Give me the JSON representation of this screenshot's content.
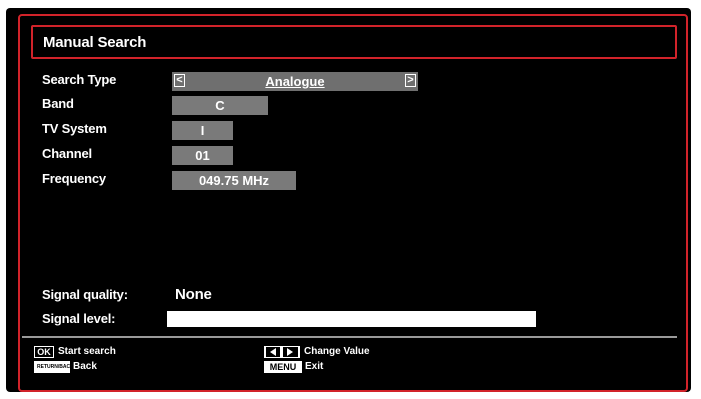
{
  "title": "Manual Search",
  "fields": {
    "search_type": {
      "label": "Search Type",
      "value": "Analogue",
      "left_arrow": "<",
      "right_arrow": ">"
    },
    "band": {
      "label": "Band",
      "value": "C"
    },
    "tv_system": {
      "label": "TV System",
      "value": "I"
    },
    "channel": {
      "label": "Channel",
      "value": "01"
    },
    "frequency": {
      "label": "Frequency",
      "value": "049.75 MHz"
    }
  },
  "signal": {
    "quality_label": "Signal quality:",
    "quality_value": "None",
    "level_label": "Signal level:"
  },
  "footer": {
    "ok_key": "OK",
    "ok_hint": "Start search",
    "back_key": "RETURN/BACK",
    "back_hint": "Back",
    "change_hint": "Change Value",
    "menu_key": "MENU",
    "menu_hint": "Exit"
  },
  "colors": {
    "frame_accent": "#d2232a",
    "field_bg": "#7a7a7a",
    "background": "#000000"
  }
}
